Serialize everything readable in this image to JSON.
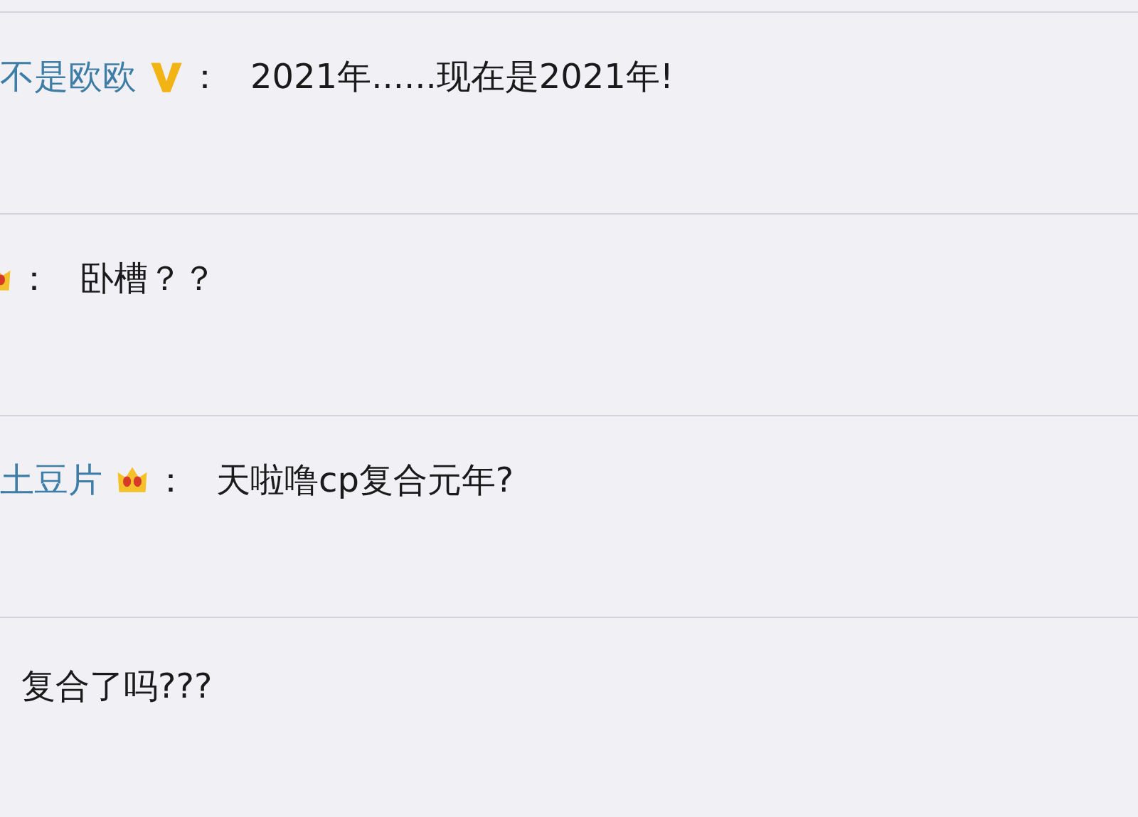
{
  "comments": [
    {
      "user": "不是欧欧",
      "badge": {
        "kind": "v"
      },
      "separator": "：",
      "text": "2021年......现在是2021年!"
    },
    {
      "badge": {
        "kind": "crown"
      },
      "separator": "：",
      "text": "卧槽？？"
    },
    {
      "user": "土豆片",
      "badge": {
        "kind": "crown"
      },
      "separator": "：",
      "text": "天啦噜cp复合元年?"
    },
    {
      "text": "复合了吗???"
    }
  ]
}
